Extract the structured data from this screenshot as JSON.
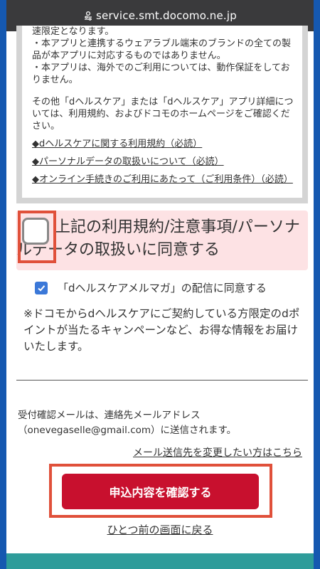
{
  "browser": {
    "url": "service.smt.docomo.ne.jp"
  },
  "terms": {
    "lines_top": [
      "速限定となります。",
      "・本アプリと連携するウェアラブル端末のブランドの全ての製品が本アプリに対応するものではありません。",
      "・本アプリは、海外でのご利用については、動作保証をしておりません。"
    ],
    "paragraph": "その他「dヘルスケア」または「dヘルスケア」アプリ詳細については、利用規約、およびドコモのホームページをご確認ください。",
    "links": [
      "◆dヘルスケアに関する利用規約（必読）",
      "◆パーソナルデータの取扱いについて（必読）",
      "◆オンライン手続きのご利用にあたって（ご利用条件）（必読）"
    ]
  },
  "agreement": {
    "label": "上記の利用規約/注意事項/パーソナルデータの取扱いに同意する",
    "checked": false
  },
  "newsletter": {
    "label": "「dヘルスケアメルマガ」の配信に同意する",
    "checked": true,
    "note": "※ドコモからdヘルスケアにご契約している方限定のdポイントが当たるキャンペーンなど、お得な情報をお届けいたします。"
  },
  "confirmation": {
    "text": "受付確認メールは、連絡先メールアドレス（onevegaselle@gmail.com）に送信されます。",
    "change_link": "メール送信先を変更したい方はこちら"
  },
  "actions": {
    "confirm_label": "申込内容を確認する",
    "back_label": "ひとつ前の画面に戻る"
  },
  "colors": {
    "primary_button": "#c8102e",
    "highlight_border": "#e0503a",
    "agree_background": "#fde2e4",
    "checkbox_checked": "#3b78d8"
  }
}
